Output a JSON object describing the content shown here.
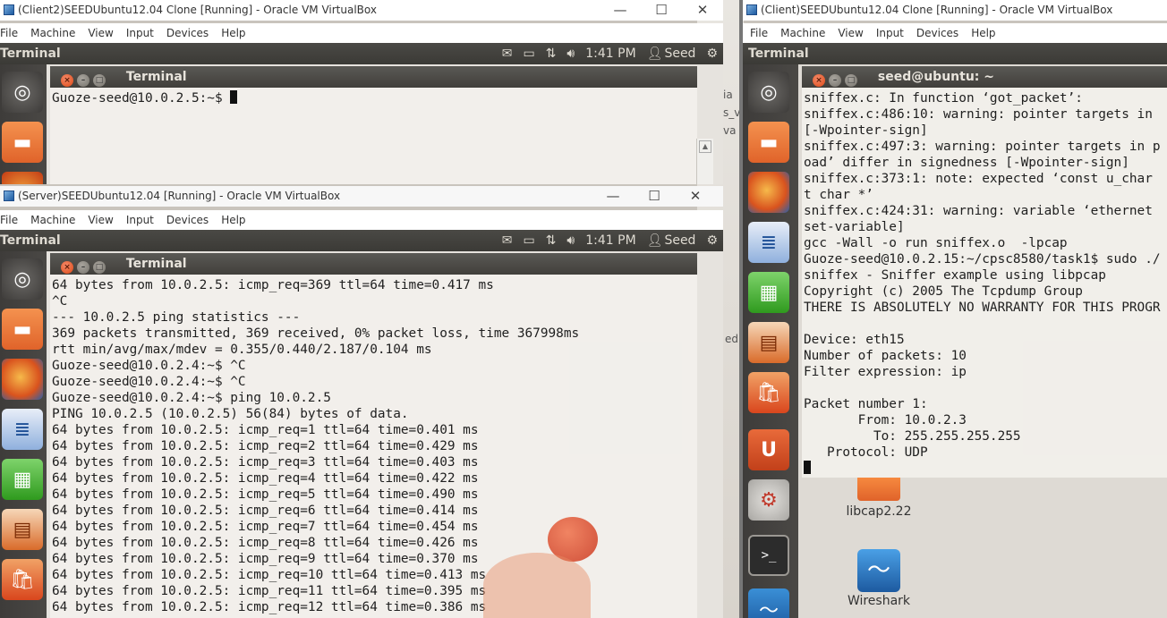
{
  "vm_client2": {
    "title": "(Client2)SEEDUbuntu12.04 Clone [Running] - Oracle VM VirtualBox",
    "menu": [
      "File",
      "Machine",
      "View",
      "Input",
      "Devices",
      "Help"
    ],
    "panel": {
      "app": "Terminal",
      "time": "1:41 PM",
      "user": "Seed"
    },
    "terminal": {
      "title": "Terminal",
      "prompt": "Guoze-seed@10.0.2.5:~$ "
    }
  },
  "vm_server": {
    "title": "(Server)SEEDUbuntu12.04 [Running] - Oracle VM VirtualBox",
    "menu": [
      "File",
      "Machine",
      "View",
      "Input",
      "Devices",
      "Help"
    ],
    "panel": {
      "app": "Terminal",
      "time": "1:41 PM",
      "user": "Seed"
    },
    "terminal": {
      "title": "Terminal",
      "lines": [
        "64 bytes from 10.0.2.5: icmp_req=369 ttl=64 time=0.417 ms",
        "^C",
        "--- 10.0.2.5 ping statistics ---",
        "369 packets transmitted, 369 received, 0% packet loss, time 367998ms",
        "rtt min/avg/max/mdev = 0.355/0.440/2.187/0.104 ms",
        "Guoze-seed@10.0.2.4:~$ ^C",
        "Guoze-seed@10.0.2.4:~$ ^C",
        "Guoze-seed@10.0.2.4:~$ ping 10.0.2.5",
        "PING 10.0.2.5 (10.0.2.5) 56(84) bytes of data.",
        "64 bytes from 10.0.2.5: icmp_req=1 ttl=64 time=0.401 ms",
        "64 bytes from 10.0.2.5: icmp_req=2 ttl=64 time=0.429 ms",
        "64 bytes from 10.0.2.5: icmp_req=3 ttl=64 time=0.403 ms",
        "64 bytes from 10.0.2.5: icmp_req=4 ttl=64 time=0.422 ms",
        "64 bytes from 10.0.2.5: icmp_req=5 ttl=64 time=0.490 ms",
        "64 bytes from 10.0.2.5: icmp_req=6 ttl=64 time=0.414 ms",
        "64 bytes from 10.0.2.5: icmp_req=7 ttl=64 time=0.454 ms",
        "64 bytes from 10.0.2.5: icmp_req=8 ttl=64 time=0.426 ms",
        "64 bytes from 10.0.2.5: icmp_req=9 ttl=64 time=0.370 ms",
        "64 bytes from 10.0.2.5: icmp_req=10 ttl=64 time=0.413 ms",
        "64 bytes from 10.0.2.5: icmp_req=11 ttl=64 time=0.395 ms",
        "64 bytes from 10.0.2.5: icmp_req=12 ttl=64 time=0.386 ms"
      ]
    }
  },
  "vm_client": {
    "title": "(Client)SEEDUbuntu12.04 Clone [Running] - Oracle VM VirtualBox",
    "menu": [
      "File",
      "Machine",
      "View",
      "Input",
      "Devices",
      "Help"
    ],
    "panel": {
      "app": "Terminal"
    },
    "terminal": {
      "title": "seed@ubuntu: ~",
      "lines": [
        "sniffex.c: In function ‘got_packet’:",
        "sniffex.c:486:10: warning: pointer targets in",
        "[-Wpointer-sign]",
        "sniffex.c:497:3: warning: pointer targets in p",
        "oad’ differ in signedness [-Wpointer-sign]",
        "sniffex.c:373:1: note: expected ‘const u_char",
        "t char *’",
        "sniffex.c:424:31: warning: variable ‘ethernet",
        "set-variable]",
        "gcc -Wall -o run sniffex.o  -lpcap",
        "Guoze-seed@10.0.2.15:~/cpsc8580/task1$ sudo ./",
        "sniffex - Sniffer example using libpcap",
        "Copyright (c) 2005 The Tcpdump Group",
        "THERE IS ABSOLUTELY NO WARRANTY FOR THIS PROGR",
        "",
        "Device: eth15",
        "Number of packets: 10",
        "Filter expression: ip",
        "",
        "Packet number 1:",
        "       From: 10.0.2.3",
        "         To: 255.255.255.255",
        "   Protocol: UDP"
      ]
    },
    "desktop_icons": [
      {
        "label": "libcap2.22"
      },
      {
        "label": "Wireshark"
      }
    ]
  },
  "window_controls": {
    "minimize": "—",
    "maximize": "☐",
    "close": "✕"
  },
  "bg_fragments": [
    "ia",
    "s_v",
    "va",
    "ed"
  ]
}
